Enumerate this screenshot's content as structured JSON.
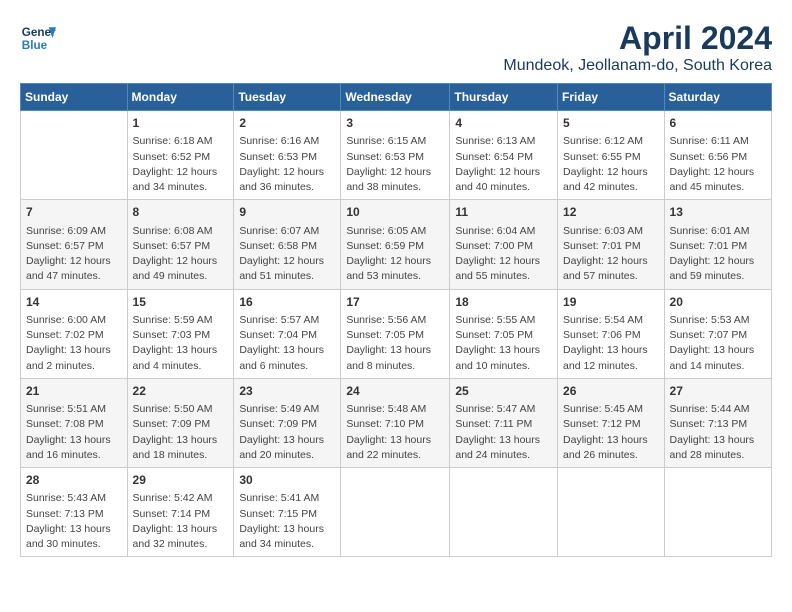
{
  "logo": {
    "line1": "General",
    "line2": "Blue"
  },
  "title": "April 2024",
  "subtitle": "Mundeok, Jeollanam-do, South Korea",
  "days_of_week": [
    "Sunday",
    "Monday",
    "Tuesday",
    "Wednesday",
    "Thursday",
    "Friday",
    "Saturday"
  ],
  "weeks": [
    [
      {
        "day": "",
        "info": ""
      },
      {
        "day": "1",
        "info": "Sunrise: 6:18 AM\nSunset: 6:52 PM\nDaylight: 12 hours\nand 34 minutes."
      },
      {
        "day": "2",
        "info": "Sunrise: 6:16 AM\nSunset: 6:53 PM\nDaylight: 12 hours\nand 36 minutes."
      },
      {
        "day": "3",
        "info": "Sunrise: 6:15 AM\nSunset: 6:53 PM\nDaylight: 12 hours\nand 38 minutes."
      },
      {
        "day": "4",
        "info": "Sunrise: 6:13 AM\nSunset: 6:54 PM\nDaylight: 12 hours\nand 40 minutes."
      },
      {
        "day": "5",
        "info": "Sunrise: 6:12 AM\nSunset: 6:55 PM\nDaylight: 12 hours\nand 42 minutes."
      },
      {
        "day": "6",
        "info": "Sunrise: 6:11 AM\nSunset: 6:56 PM\nDaylight: 12 hours\nand 45 minutes."
      }
    ],
    [
      {
        "day": "7",
        "info": "Sunrise: 6:09 AM\nSunset: 6:57 PM\nDaylight: 12 hours\nand 47 minutes."
      },
      {
        "day": "8",
        "info": "Sunrise: 6:08 AM\nSunset: 6:57 PM\nDaylight: 12 hours\nand 49 minutes."
      },
      {
        "day": "9",
        "info": "Sunrise: 6:07 AM\nSunset: 6:58 PM\nDaylight: 12 hours\nand 51 minutes."
      },
      {
        "day": "10",
        "info": "Sunrise: 6:05 AM\nSunset: 6:59 PM\nDaylight: 12 hours\nand 53 minutes."
      },
      {
        "day": "11",
        "info": "Sunrise: 6:04 AM\nSunset: 7:00 PM\nDaylight: 12 hours\nand 55 minutes."
      },
      {
        "day": "12",
        "info": "Sunrise: 6:03 AM\nSunset: 7:01 PM\nDaylight: 12 hours\nand 57 minutes."
      },
      {
        "day": "13",
        "info": "Sunrise: 6:01 AM\nSunset: 7:01 PM\nDaylight: 12 hours\nand 59 minutes."
      }
    ],
    [
      {
        "day": "14",
        "info": "Sunrise: 6:00 AM\nSunset: 7:02 PM\nDaylight: 13 hours\nand 2 minutes."
      },
      {
        "day": "15",
        "info": "Sunrise: 5:59 AM\nSunset: 7:03 PM\nDaylight: 13 hours\nand 4 minutes."
      },
      {
        "day": "16",
        "info": "Sunrise: 5:57 AM\nSunset: 7:04 PM\nDaylight: 13 hours\nand 6 minutes."
      },
      {
        "day": "17",
        "info": "Sunrise: 5:56 AM\nSunset: 7:05 PM\nDaylight: 13 hours\nand 8 minutes."
      },
      {
        "day": "18",
        "info": "Sunrise: 5:55 AM\nSunset: 7:05 PM\nDaylight: 13 hours\nand 10 minutes."
      },
      {
        "day": "19",
        "info": "Sunrise: 5:54 AM\nSunset: 7:06 PM\nDaylight: 13 hours\nand 12 minutes."
      },
      {
        "day": "20",
        "info": "Sunrise: 5:53 AM\nSunset: 7:07 PM\nDaylight: 13 hours\nand 14 minutes."
      }
    ],
    [
      {
        "day": "21",
        "info": "Sunrise: 5:51 AM\nSunset: 7:08 PM\nDaylight: 13 hours\nand 16 minutes."
      },
      {
        "day": "22",
        "info": "Sunrise: 5:50 AM\nSunset: 7:09 PM\nDaylight: 13 hours\nand 18 minutes."
      },
      {
        "day": "23",
        "info": "Sunrise: 5:49 AM\nSunset: 7:09 PM\nDaylight: 13 hours\nand 20 minutes."
      },
      {
        "day": "24",
        "info": "Sunrise: 5:48 AM\nSunset: 7:10 PM\nDaylight: 13 hours\nand 22 minutes."
      },
      {
        "day": "25",
        "info": "Sunrise: 5:47 AM\nSunset: 7:11 PM\nDaylight: 13 hours\nand 24 minutes."
      },
      {
        "day": "26",
        "info": "Sunrise: 5:45 AM\nSunset: 7:12 PM\nDaylight: 13 hours\nand 26 minutes."
      },
      {
        "day": "27",
        "info": "Sunrise: 5:44 AM\nSunset: 7:13 PM\nDaylight: 13 hours\nand 28 minutes."
      }
    ],
    [
      {
        "day": "28",
        "info": "Sunrise: 5:43 AM\nSunset: 7:13 PM\nDaylight: 13 hours\nand 30 minutes."
      },
      {
        "day": "29",
        "info": "Sunrise: 5:42 AM\nSunset: 7:14 PM\nDaylight: 13 hours\nand 32 minutes."
      },
      {
        "day": "30",
        "info": "Sunrise: 5:41 AM\nSunset: 7:15 PM\nDaylight: 13 hours\nand 34 minutes."
      },
      {
        "day": "",
        "info": ""
      },
      {
        "day": "",
        "info": ""
      },
      {
        "day": "",
        "info": ""
      },
      {
        "day": "",
        "info": ""
      }
    ]
  ]
}
